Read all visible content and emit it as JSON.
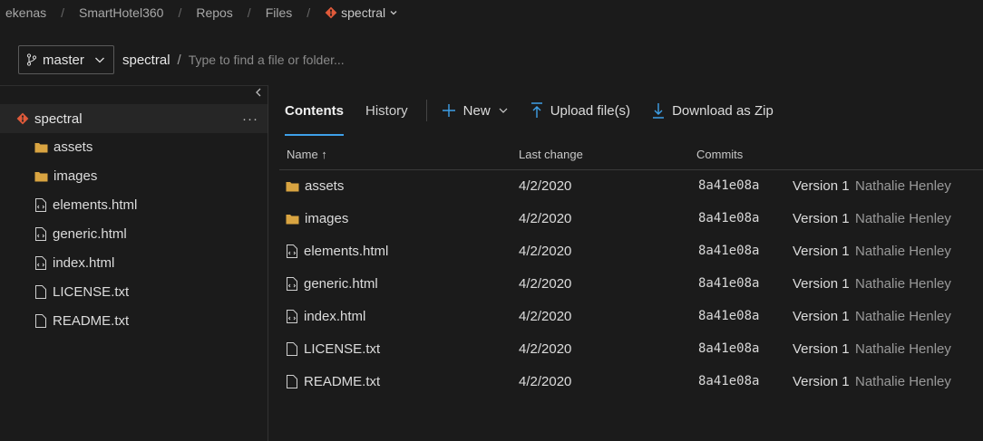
{
  "breadcrumbs": [
    "ekenas",
    "SmartHotel360",
    "Repos",
    "Files"
  ],
  "repo_name": "spectral",
  "branch": "master",
  "path_root": "spectral",
  "path_sep": "/",
  "path_placeholder": "Type to find a file or folder...",
  "tabs": [
    "Contents",
    "History"
  ],
  "actions": {
    "new": "New",
    "upload": "Upload file(s)",
    "download": "Download as Zip"
  },
  "columns": {
    "name": "Name ↑",
    "last_change": "Last change",
    "commits": "Commits"
  },
  "tree": {
    "root": "spectral",
    "items": [
      {
        "name": "assets",
        "kind": "folder"
      },
      {
        "name": "images",
        "kind": "folder"
      },
      {
        "name": "elements.html",
        "kind": "code"
      },
      {
        "name": "generic.html",
        "kind": "code"
      },
      {
        "name": "index.html",
        "kind": "code"
      },
      {
        "name": "LICENSE.txt",
        "kind": "file"
      },
      {
        "name": "README.txt",
        "kind": "file"
      }
    ]
  },
  "rows": [
    {
      "name": "assets",
      "kind": "folder",
      "date": "4/2/2020",
      "commit": "8a41e08a",
      "message": "Version 1",
      "author": "Nathalie Henley"
    },
    {
      "name": "images",
      "kind": "folder",
      "date": "4/2/2020",
      "commit": "8a41e08a",
      "message": "Version 1",
      "author": "Nathalie Henley"
    },
    {
      "name": "elements.html",
      "kind": "code",
      "date": "4/2/2020",
      "commit": "8a41e08a",
      "message": "Version 1",
      "author": "Nathalie Henley"
    },
    {
      "name": "generic.html",
      "kind": "code",
      "date": "4/2/2020",
      "commit": "8a41e08a",
      "message": "Version 1",
      "author": "Nathalie Henley"
    },
    {
      "name": "index.html",
      "kind": "code",
      "date": "4/2/2020",
      "commit": "8a41e08a",
      "message": "Version 1",
      "author": "Nathalie Henley"
    },
    {
      "name": "LICENSE.txt",
      "kind": "file",
      "date": "4/2/2020",
      "commit": "8a41e08a",
      "message": "Version 1",
      "author": "Nathalie Henley"
    },
    {
      "name": "README.txt",
      "kind": "file",
      "date": "4/2/2020",
      "commit": "8a41e08a",
      "message": "Version 1",
      "author": "Nathalie Henley"
    }
  ],
  "colors": {
    "accent": "#3ea0e8",
    "git": "#e05a3a",
    "folder": "#d9a441"
  }
}
